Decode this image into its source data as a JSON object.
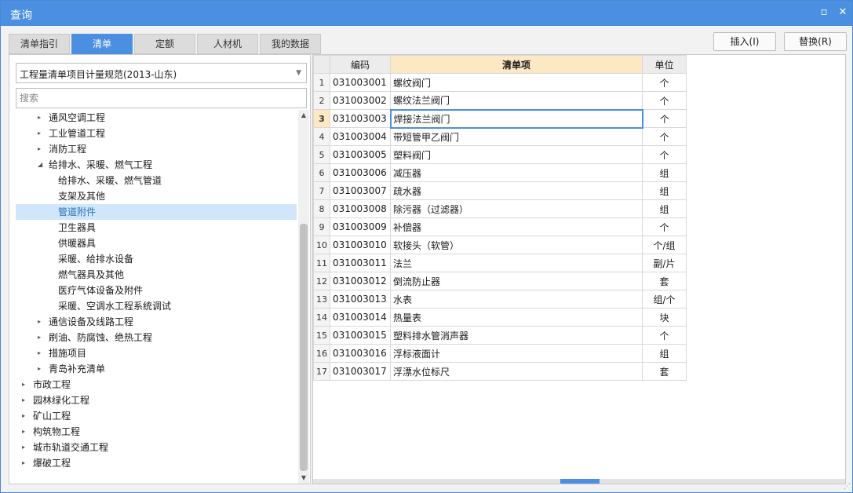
{
  "window": {
    "title": "查询",
    "restore_glyph": "▫",
    "close_glyph": "✕"
  },
  "tabs": [
    {
      "label": "清单指引",
      "active": false
    },
    {
      "label": "清单",
      "active": true
    },
    {
      "label": "定额",
      "active": false
    },
    {
      "label": "人材机",
      "active": false
    },
    {
      "label": "我的数据",
      "active": false
    }
  ],
  "actions": {
    "insert_label": "插入(I)",
    "replace_label": "替换(R)"
  },
  "left": {
    "spec_value": "工程量清单项目计量规范(2013-山东)",
    "search_placeholder": "搜索",
    "tree": [
      {
        "label": "通风空调工程",
        "level": 1,
        "caret": "▸",
        "selected": false
      },
      {
        "label": "工业管道工程",
        "level": 1,
        "caret": "▸",
        "selected": false
      },
      {
        "label": "消防工程",
        "level": 1,
        "caret": "▸",
        "selected": false
      },
      {
        "label": "给排水、采暖、燃气工程",
        "level": 1,
        "caret": "◢",
        "selected": false
      },
      {
        "label": "给排水、采暖、燃气管道",
        "level": 2,
        "caret": "",
        "selected": false
      },
      {
        "label": "支架及其他",
        "level": 2,
        "caret": "",
        "selected": false
      },
      {
        "label": "管道附件",
        "level": 2,
        "caret": "",
        "selected": true
      },
      {
        "label": "卫生器具",
        "level": 2,
        "caret": "",
        "selected": false
      },
      {
        "label": "供暖器具",
        "level": 2,
        "caret": "",
        "selected": false
      },
      {
        "label": "采暖、给排水设备",
        "level": 2,
        "caret": "",
        "selected": false
      },
      {
        "label": "燃气器具及其他",
        "level": 2,
        "caret": "",
        "selected": false
      },
      {
        "label": "医疗气体设备及附件",
        "level": 2,
        "caret": "",
        "selected": false
      },
      {
        "label": "采暖、空调水工程系统调试",
        "level": 2,
        "caret": "",
        "selected": false
      },
      {
        "label": "通信设备及线路工程",
        "level": 1,
        "caret": "▸",
        "selected": false
      },
      {
        "label": "刷油、防腐蚀、绝热工程",
        "level": 1,
        "caret": "▸",
        "selected": false
      },
      {
        "label": "措施项目",
        "level": 1,
        "caret": "▸",
        "selected": false
      },
      {
        "label": "青岛补充清单",
        "level": 1,
        "caret": "▸",
        "selected": false
      },
      {
        "label": "市政工程",
        "level": 0,
        "caret": "▸",
        "selected": false
      },
      {
        "label": "园林绿化工程",
        "level": 0,
        "caret": "▸",
        "selected": false
      },
      {
        "label": "矿山工程",
        "level": 0,
        "caret": "▸",
        "selected": false
      },
      {
        "label": "构筑物工程",
        "level": 0,
        "caret": "▸",
        "selected": false
      },
      {
        "label": "城市轨道交通工程",
        "level": 0,
        "caret": "▸",
        "selected": false
      },
      {
        "label": "爆破工程",
        "level": 0,
        "caret": "▸",
        "selected": false
      }
    ]
  },
  "grid": {
    "headers": {
      "code": "编码",
      "name": "清单项",
      "unit": "单位"
    },
    "current_row": 3,
    "rows": [
      {
        "no": "1",
        "code": "031003001",
        "name": "螺纹阀门",
        "unit": "个"
      },
      {
        "no": "2",
        "code": "031003002",
        "name": "螺纹法兰阀门",
        "unit": "个"
      },
      {
        "no": "3",
        "code": "031003003",
        "name": "焊接法兰阀门",
        "unit": "个"
      },
      {
        "no": "4",
        "code": "031003004",
        "name": "带短管甲乙阀门",
        "unit": "个"
      },
      {
        "no": "5",
        "code": "031003005",
        "name": "塑料阀门",
        "unit": "个"
      },
      {
        "no": "6",
        "code": "031003006",
        "name": "减压器",
        "unit": "组"
      },
      {
        "no": "7",
        "code": "031003007",
        "name": "疏水器",
        "unit": "组"
      },
      {
        "no": "8",
        "code": "031003008",
        "name": "除污器（过滤器）",
        "unit": "组"
      },
      {
        "no": "9",
        "code": "031003009",
        "name": "补偿器",
        "unit": "个"
      },
      {
        "no": "10",
        "code": "031003010",
        "name": "软接头（软管）",
        "unit": "个/组"
      },
      {
        "no": "11",
        "code": "031003011",
        "name": "法兰",
        "unit": "副/片"
      },
      {
        "no": "12",
        "code": "031003012",
        "name": "倒流防止器",
        "unit": "套"
      },
      {
        "no": "13",
        "code": "031003013",
        "name": "水表",
        "unit": "组/个"
      },
      {
        "no": "14",
        "code": "031003014",
        "name": "热量表",
        "unit": "块"
      },
      {
        "no": "15",
        "code": "031003015",
        "name": "塑料排水管消声器",
        "unit": "个"
      },
      {
        "no": "16",
        "code": "031003016",
        "name": "浮标液面计",
        "unit": "组"
      },
      {
        "no": "17",
        "code": "031003017",
        "name": "浮漂水位标尺",
        "unit": "套"
      }
    ]
  },
  "scroll": {
    "up_glyph": "▲",
    "down_glyph": "▼",
    "grip_glyph": "⋰"
  },
  "colors": {
    "accent": "#4a8fe0",
    "header_highlight": "#fde8c4",
    "tree_selected": "#cfe6fb"
  }
}
